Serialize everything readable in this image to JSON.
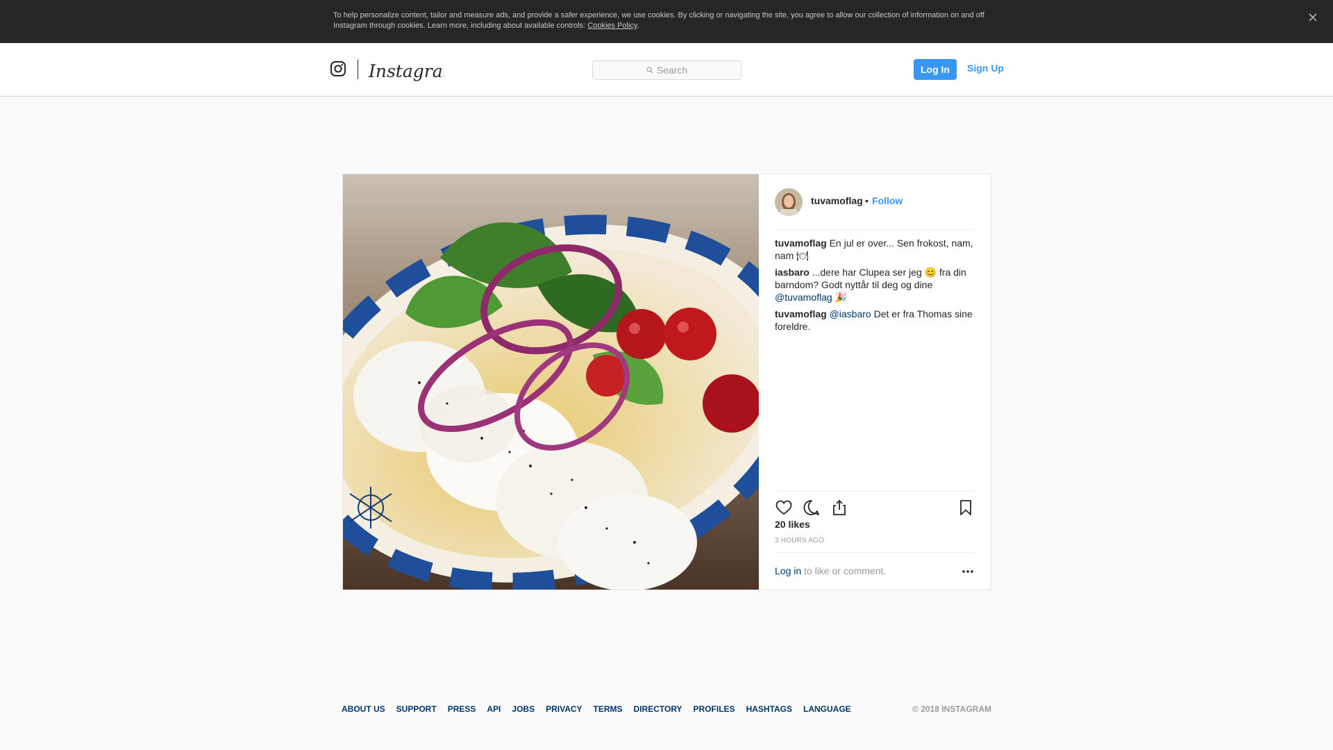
{
  "cookie_banner": {
    "text": "To help personalize content, tailor and measure ads, and provide a safer experience, we use cookies. By clicking or navigating the site, you agree to allow our collection of information on and off Instagram through cookies. Learn more, including about available controls: ",
    "link": "Cookies Policy",
    "after_link": "."
  },
  "header": {
    "brand": "Instagram",
    "search_placeholder": "Search",
    "login_label": "Log In",
    "signup_label": "Sign Up",
    "accent": "#3897f0"
  },
  "post": {
    "author": "tuvamoflag",
    "dot": "•",
    "follow": "Follow",
    "comments": [
      {
        "user": "tuvamoflag",
        "mention": "",
        "text": "En jul er over... Sen frokost, nam, nam 🍽",
        "trail": ""
      },
      {
        "user": "iasbaro",
        "mention": "",
        "text": "...dere har Clupea ser jeg 😊 fra din barndom? Godt nyttår til deg og dine ",
        "trail_mention": "@tuvamoflag",
        "trail": " 🎉"
      },
      {
        "user": "tuvamoflag",
        "mention": "@iasbaro",
        "text": " Det er fra Thomas sine foreldre.",
        "trail": ""
      }
    ],
    "likes": "20 likes",
    "time_ago": "3 HOURS AGO",
    "login_link": "Log in",
    "login_text": " to like or comment."
  },
  "footer": {
    "links": [
      "ABOUT US",
      "SUPPORT",
      "PRESS",
      "API",
      "JOBS",
      "PRIVACY",
      "TERMS",
      "DIRECTORY",
      "PROFILES",
      "HASHTAGS",
      "LANGUAGE"
    ],
    "copyright": "© 2018 INSTAGRAM"
  }
}
